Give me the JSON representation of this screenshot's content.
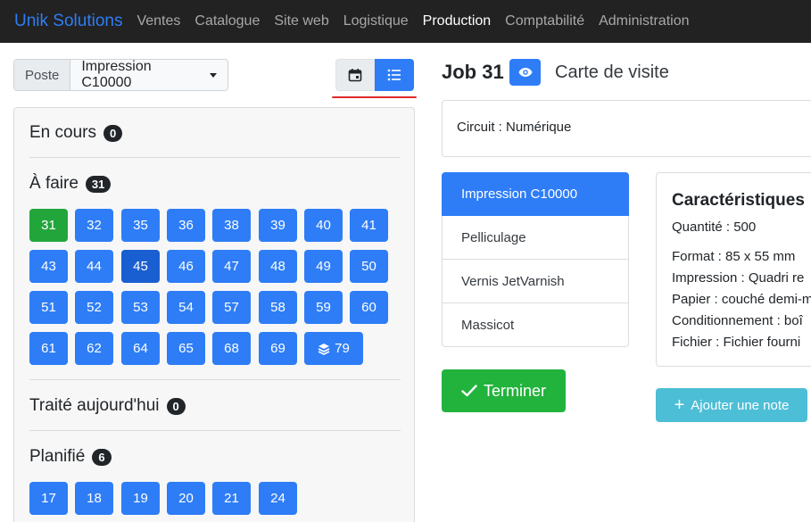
{
  "navbar": {
    "brand": "Unik Solutions",
    "items": [
      "Ventes",
      "Catalogue",
      "Site web",
      "Logistique",
      "Production",
      "Comptabilité",
      "Administration"
    ],
    "active": "Production"
  },
  "filter": {
    "poste_label": "Poste",
    "poste_value": "Impression C10000"
  },
  "view_toggle": {
    "calendar_icon": "calendar-icon",
    "list_icon": "list-icon",
    "active": "list"
  },
  "sections": {
    "en_cours": {
      "title": "En cours",
      "count": "0"
    },
    "a_faire": {
      "title": "À faire",
      "count": "31",
      "jobs": [
        "31",
        "32",
        "35",
        "36",
        "38",
        "39",
        "40",
        "41",
        "43",
        "44",
        "45",
        "46",
        "47",
        "48",
        "49",
        "50",
        "51",
        "52",
        "53",
        "54",
        "57",
        "58",
        "59",
        "60",
        "61",
        "62",
        "64",
        "65",
        "68",
        "69"
      ],
      "group": {
        "icon": "layers-icon",
        "label": "79"
      },
      "current": "31",
      "hovered": "45"
    },
    "traite": {
      "title": "Traité aujourd'hui",
      "count": "0"
    },
    "planifie": {
      "title": "Planifié",
      "count": "6",
      "jobs": [
        "17",
        "18",
        "19",
        "20",
        "21",
        "24"
      ]
    }
  },
  "job": {
    "title": "Job 31",
    "subtitle": "Carte de visite",
    "circuit": "Circuit : Numérique",
    "steps": [
      "Impression C10000",
      "Pelliculage",
      "Vernis JetVarnish",
      "Massicot"
    ],
    "active_step": "Impression C10000"
  },
  "characteristics": {
    "title": "Caractéristiques",
    "quantity": "Quantité : 500",
    "format": "Format : 85 x 55 mm",
    "impression": "Impression : Quadri re",
    "papier": "Papier : couché demi-m",
    "conditionnement": "Conditionnement : boî",
    "fichier": "Fichier : Fichier fourni"
  },
  "actions": {
    "terminer": "Terminer",
    "add_note": "Ajouter une note"
  },
  "colors": {
    "primary": "#2e7df6",
    "success": "#22b33c",
    "info": "#4cbed6",
    "navbar": "#222222",
    "highlight": "#e02b2b"
  }
}
